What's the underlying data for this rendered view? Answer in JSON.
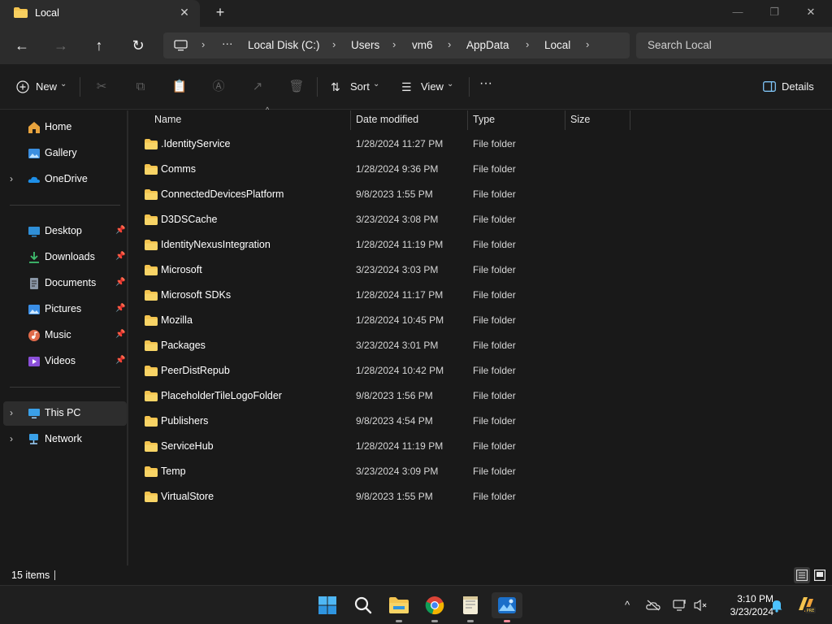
{
  "window": {
    "tab_title": "Local",
    "tab_close_glyph": "✕",
    "new_tab_glyph": "+",
    "minimize_glyph": "—",
    "maximize_glyph": "❐",
    "close_glyph": "✕"
  },
  "nav": {
    "back_glyph": "←",
    "forward_glyph": "→",
    "up_glyph": "↑",
    "refresh_glyph": "↻",
    "address": {
      "more_glyph": "···",
      "separator": "›",
      "crumbs": [
        "Local Disk (C:)",
        "Users",
        "vm6",
        "AppData",
        "Local"
      ]
    },
    "search_placeholder": "Search Local"
  },
  "commandbar": {
    "new_label": "New",
    "sort_label": "Sort",
    "view_label": "View",
    "more_glyph": "···",
    "details_label": "Details",
    "dropdown_glyph": "⌄"
  },
  "sidebar": {
    "chevron": "›",
    "pin_glyph": "📌",
    "top": [
      {
        "label": "Home",
        "icon": "home-icon",
        "color": "#e8a33d"
      },
      {
        "label": "Gallery",
        "icon": "gallery-icon",
        "color": "#3b8fe0"
      },
      {
        "label": "OneDrive",
        "icon": "onedrive-icon",
        "color": "#1e8fe8"
      }
    ],
    "quick": [
      {
        "label": "Desktop",
        "icon": "desktop-icon",
        "color": "#2f8fd8"
      },
      {
        "label": "Downloads",
        "icon": "downloads-icon",
        "color": "#3fbf6f"
      },
      {
        "label": "Documents",
        "icon": "documents-icon",
        "color": "#8a96a6"
      },
      {
        "label": "Pictures",
        "icon": "pictures-icon",
        "color": "#3a8ee6"
      },
      {
        "label": "Music",
        "icon": "music-icon",
        "color": "#e06a4a"
      },
      {
        "label": "Videos",
        "icon": "videos-icon",
        "color": "#8a4fd8"
      }
    ],
    "bottom": [
      {
        "label": "This PC",
        "icon": "this-pc-icon",
        "color": "#3aa0e8"
      },
      {
        "label": "Network",
        "icon": "network-icon",
        "color": "#3aa0e8"
      }
    ]
  },
  "columns": {
    "name": "Name",
    "date": "Date modified",
    "type": "Type",
    "size": "Size",
    "sort_glyph": "^"
  },
  "files": [
    {
      "name": ".IdentityService",
      "date": "1/28/2024 11:27 PM",
      "type": "File folder"
    },
    {
      "name": "Comms",
      "date": "1/28/2024 9:36 PM",
      "type": "File folder"
    },
    {
      "name": "ConnectedDevicesPlatform",
      "date": "9/8/2023 1:55 PM",
      "type": "File folder"
    },
    {
      "name": "D3DSCache",
      "date": "3/23/2024 3:08 PM",
      "type": "File folder"
    },
    {
      "name": "IdentityNexusIntegration",
      "date": "1/28/2024 11:19 PM",
      "type": "File folder"
    },
    {
      "name": "Microsoft",
      "date": "3/23/2024 3:03 PM",
      "type": "File folder"
    },
    {
      "name": "Microsoft SDKs",
      "date": "1/28/2024 11:17 PM",
      "type": "File folder"
    },
    {
      "name": "Mozilla",
      "date": "1/28/2024 10:45 PM",
      "type": "File folder"
    },
    {
      "name": "Packages",
      "date": "3/23/2024 3:01 PM",
      "type": "File folder"
    },
    {
      "name": "PeerDistRepub",
      "date": "1/28/2024 10:42 PM",
      "type": "File folder"
    },
    {
      "name": "PlaceholderTileLogoFolder",
      "date": "9/8/2023 1:56 PM",
      "type": "File folder"
    },
    {
      "name": "Publishers",
      "date": "9/8/2023 4:54 PM",
      "type": "File folder"
    },
    {
      "name": "ServiceHub",
      "date": "1/28/2024 11:19 PM",
      "type": "File folder"
    },
    {
      "name": "Temp",
      "date": "3/23/2024 3:09 PM",
      "type": "File folder"
    },
    {
      "name": "VirtualStore",
      "date": "9/8/2023 1:55 PM",
      "type": "File folder"
    }
  ],
  "status": {
    "count": "15 items"
  },
  "taskbar": {
    "apps": [
      "start-icon",
      "search-icon",
      "file-explorer-icon",
      "chrome-icon",
      "notepad-icon",
      "photos-icon"
    ],
    "tray_chevron": "^",
    "time": "3:10 PM",
    "date": "3/23/2024"
  },
  "colors": {
    "folder": "#f4c44f",
    "accent": "#4cc2ff"
  }
}
